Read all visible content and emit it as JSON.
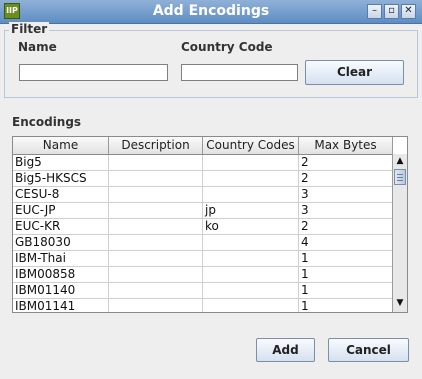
{
  "window": {
    "title": "Add Encodings",
    "app_icon_text": "IIP"
  },
  "filter": {
    "title": "Filter",
    "name_label": "Name",
    "name_value": "",
    "country_label": "Country Code",
    "country_value": "",
    "clear_label": "Clear"
  },
  "encodings": {
    "title": "Encodings",
    "columns": [
      "Name",
      "Description",
      "Country Codes",
      "Max Bytes"
    ],
    "rows": [
      [
        "Big5",
        "",
        "",
        "2"
      ],
      [
        "Big5-HKSCS",
        "",
        "",
        "2"
      ],
      [
        "CESU-8",
        "",
        "",
        "3"
      ],
      [
        "EUC-JP",
        "",
        "jp",
        "3"
      ],
      [
        "EUC-KR",
        "",
        "ko",
        "2"
      ],
      [
        "GB18030",
        "",
        "",
        "4"
      ],
      [
        "IBM-Thai",
        "",
        "",
        "1"
      ],
      [
        "IBM00858",
        "",
        "",
        "1"
      ],
      [
        "IBM01140",
        "",
        "",
        "1"
      ],
      [
        "IBM01141",
        "",
        "",
        "1"
      ]
    ]
  },
  "actions": {
    "add_label": "Add",
    "cancel_label": "Cancel"
  },
  "icons": {
    "minimize": "minimize-icon",
    "maximize": "maximize-icon",
    "close": "close-icon",
    "scroll_up": "arrow-up-icon",
    "scroll_down": "arrow-down-icon"
  }
}
